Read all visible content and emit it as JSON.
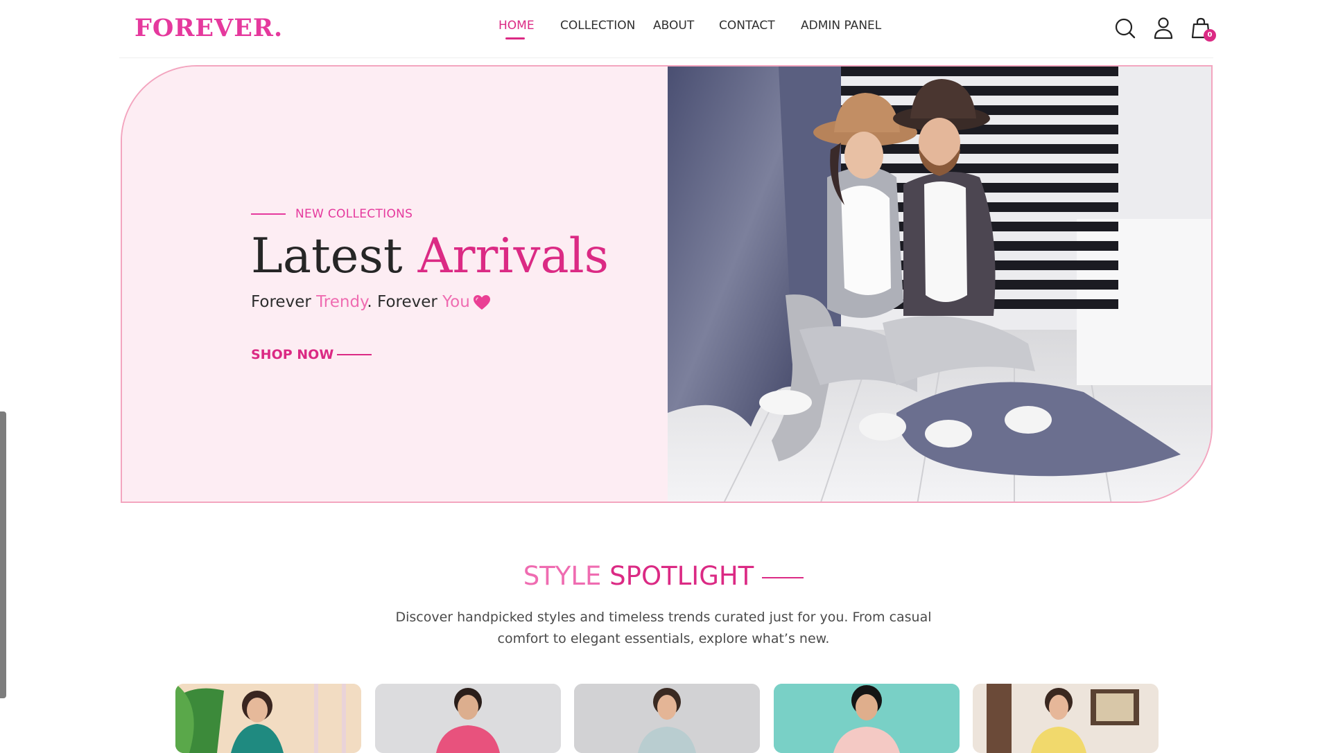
{
  "brand": {
    "logo": "FOREVER."
  },
  "nav": {
    "items": [
      {
        "label": "HOME",
        "active": true
      },
      {
        "label": "COLLECTION",
        "active": false
      },
      {
        "label": "ABOUT",
        "active": false
      },
      {
        "label": "CONTACT",
        "active": false
      },
      {
        "label": "ADMIN PANEL",
        "active": false
      }
    ]
  },
  "header_icons": [
    "search-icon",
    "user-icon",
    "shopping-bag-icon"
  ],
  "cart": {
    "count": "0"
  },
  "hero": {
    "eyebrow": "NEW COLLECTIONS",
    "title_part1": "Latest",
    "title_part2": "Arrivals",
    "tagline": {
      "w1": "Forever",
      "w2": "Trendy",
      "w3": ". Forever",
      "w4": "You"
    },
    "cta": "SHOP NOW",
    "image": "photo of a couple in hats and grey outfits sitting on a floor"
  },
  "spotlight": {
    "title_part1": "STYLE",
    "title_part2": "SPOTLIGHT",
    "description": "Discover handpicked styles and timeless trends curated just for you. From casual comfort to elegant essentials, explore what’s new."
  },
  "product_cards": [
    {
      "image": "girl in green ethnic dress"
    },
    {
      "image": "boy in pink kurta"
    },
    {
      "image": "girl in light blue dress"
    },
    {
      "image": "boy in light jacket"
    },
    {
      "image": "girl in yellow ethnic dress"
    }
  ],
  "colors": {
    "accent": "#db2a84",
    "accent_light": "#ef6cb1",
    "hero_bg": "#fdedf3",
    "hero_border": "#f3a5bf"
  }
}
